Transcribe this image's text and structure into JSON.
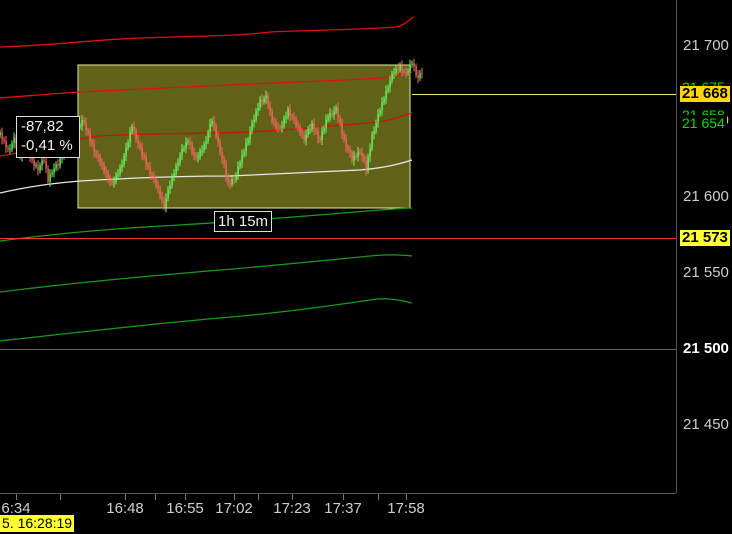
{
  "chart_data": {
    "type": "candlestick",
    "y_ticks": [
      "21 700",
      "21 650",
      "21 600",
      "21 550",
      "21 500",
      "21 450"
    ],
    "y_tick_values": [
      21700,
      21650,
      21600,
      21550,
      21500,
      21450
    ],
    "ylim": [
      21405,
      21730
    ],
    "x_ticks": [
      "6:34",
      "16:48",
      "16:55",
      "17:02",
      "17:23",
      "17:37",
      "17:58"
    ],
    "price_badges": [
      {
        "label": "21 676",
        "value": 21676,
        "color": "#ff2020",
        "bg": "#000"
      },
      {
        "label": "21 675",
        "value": 21675,
        "color": "#00dd00",
        "bg": "#000"
      },
      {
        "label": "21 668",
        "value": 21668,
        "color": "#000",
        "bg": "#ffd700"
      },
      {
        "label": "21 658",
        "value": 21658,
        "color": "#00dd00",
        "bg": "#000"
      },
      {
        "label": "21 654",
        "value": 21654,
        "color": "#00dd00",
        "bg": "#000"
      },
      {
        "label": "21 573",
        "value": 21573,
        "color": "#000",
        "bg": "#ffff33"
      }
    ],
    "horizontal_lines": [
      {
        "value": 21668,
        "color": "#ffe27a"
      },
      {
        "value": 21573,
        "color": "#ff3030"
      },
      {
        "value": 21500,
        "color": "#666666"
      }
    ],
    "measure": {
      "change": "-87,82",
      "percent": "-0,41 %",
      "duration": "1h 15m",
      "high": 21668,
      "low": 21581
    },
    "colors": {
      "up": "#66ff66",
      "down": "#ff6666",
      "accent": "#ffff33",
      "range_fill": "#6b6b1a"
    }
  },
  "cursor_date": "5. 16:28:19"
}
